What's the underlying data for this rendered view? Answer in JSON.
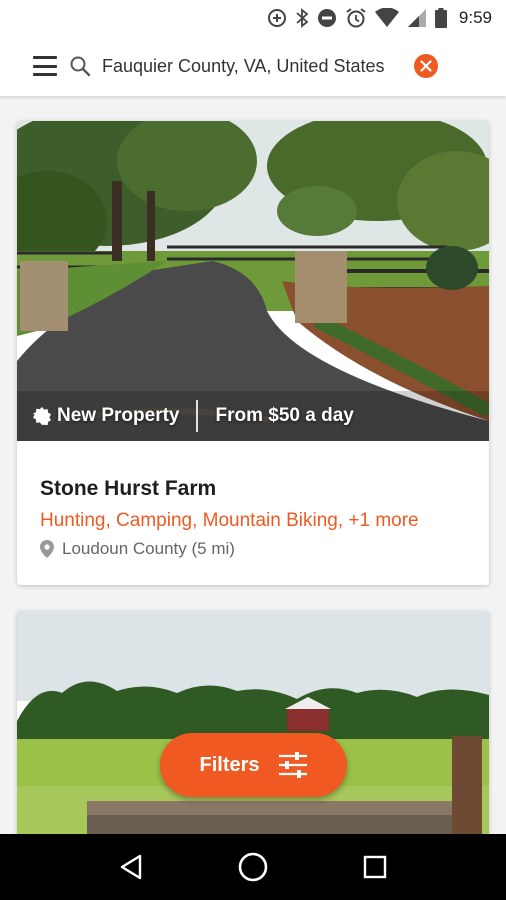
{
  "status_bar": {
    "time": "9:59",
    "icons": [
      "data-saver-icon",
      "bluetooth-icon",
      "do-not-disturb-icon",
      "alarm-icon",
      "wifi-icon",
      "cellular-icon",
      "battery-icon"
    ]
  },
  "search": {
    "value": "Fauquier County, VA, United States",
    "icons": {
      "menu": "menu-icon",
      "search": "search-icon",
      "clear": "close-icon"
    }
  },
  "listings": [
    {
      "badge": "New Property",
      "price": "From $50 a day",
      "title": "Stone Hurst Farm",
      "activities": "Hunting, Camping, Mountain Biking, +1 more",
      "location": "Loudoun County (5 mi)"
    }
  ],
  "filters": {
    "label": "Filters",
    "icon": "sliders-icon"
  },
  "nav": {
    "icons": [
      "back-icon",
      "home-icon",
      "recents-icon"
    ]
  },
  "colors": {
    "accent": "#f05a22",
    "nav": "#000000"
  }
}
